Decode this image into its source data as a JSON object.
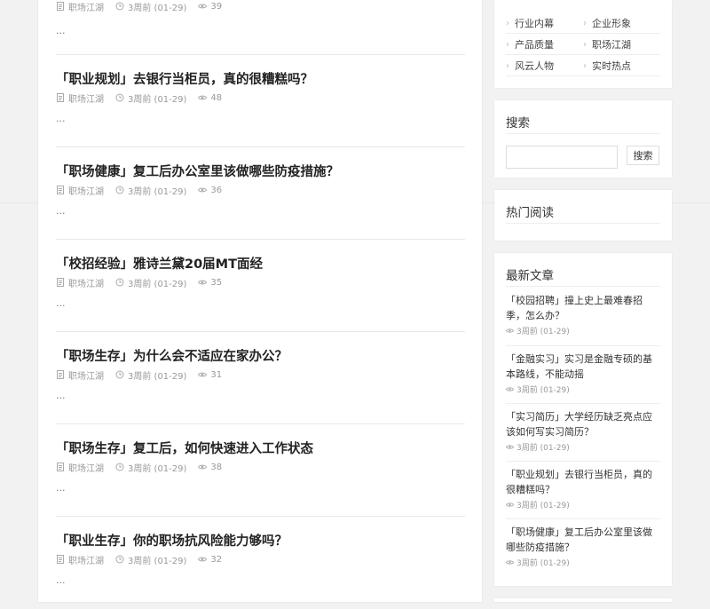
{
  "main": {
    "top_meta": {
      "category": "职场江湖",
      "time": "3周前 (01-29)",
      "views": "39"
    },
    "top_excerpt": "...",
    "posts": [
      {
        "title": "「职业规划」去银行当柜员，真的很糟糕吗？",
        "category": "职场江湖",
        "time": "3周前 (01-29)",
        "views": "48",
        "excerpt": "..."
      },
      {
        "title": "「职场健康」复工后办公室里该做哪些防疫措施？",
        "category": "职场江湖",
        "time": "3周前 (01-29)",
        "views": "36",
        "excerpt": "..."
      },
      {
        "title": "「校招经验」雅诗兰黛20届MT面经",
        "category": "职场江湖",
        "time": "3周前 (01-29)",
        "views": "35",
        "excerpt": "..."
      },
      {
        "title": "「职场生存」为什么会不适应在家办公？",
        "category": "职场江湖",
        "time": "3周前 (01-29)",
        "views": "31",
        "excerpt": "..."
      },
      {
        "title": "「职场生存」复工后，如何快速进入工作状态",
        "category": "职场江湖",
        "time": "3周前 (01-29)",
        "views": "38",
        "excerpt": "..."
      },
      {
        "title": "「职业生存」你的职场抗风险能力够吗？",
        "category": "职场江湖",
        "time": "3周前 (01-29)",
        "views": "32",
        "excerpt": "..."
      }
    ]
  },
  "sidebar": {
    "categories": [
      [
        "行业内幕",
        "企业形象"
      ],
      [
        "产品质量",
        "职场江湖"
      ],
      [
        "风云人物",
        "实时热点"
      ]
    ],
    "search": {
      "title": "搜索",
      "button": "搜索",
      "placeholder": ""
    },
    "hot": {
      "title": "热门阅读"
    },
    "latest": {
      "title": "最新文章",
      "items": [
        {
          "title": "「校园招聘」撞上史上最难春招季，怎么办？",
          "time": "3周前 (01-29)"
        },
        {
          "title": "「金融实习」实习是金融专硕的基本路线，不能动摇",
          "time": "3周前 (01-29)"
        },
        {
          "title": "「实习简历」大学经历缺乏亮点应该如何写实习简历？",
          "time": "3周前 (01-29)"
        },
        {
          "title": "「职业规划」去银行当柜员，真的很糟糕吗？",
          "time": "3周前 (01-29)"
        },
        {
          "title": "「职场健康」复工后办公室里该做哪些防疫措施？",
          "time": "3周前 (01-29)"
        }
      ]
    }
  },
  "icons": {
    "category": "document-icon",
    "time": "clock-icon",
    "views": "eye-icon"
  }
}
